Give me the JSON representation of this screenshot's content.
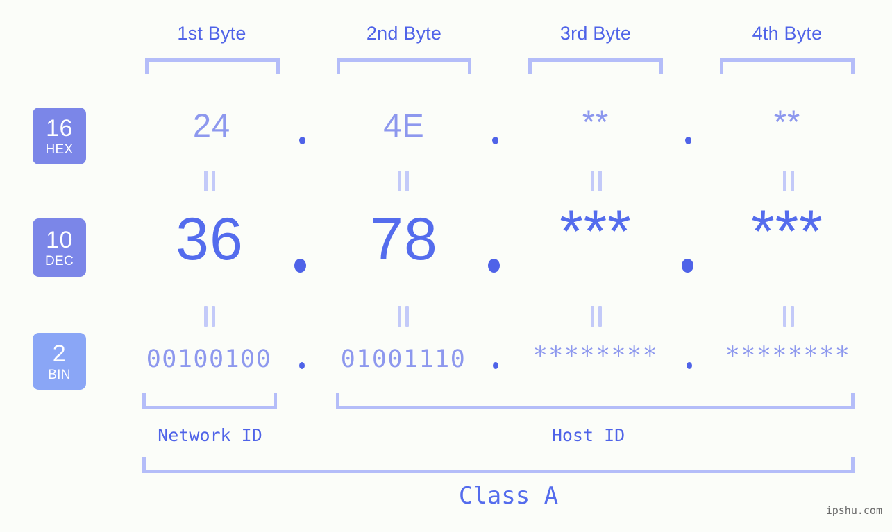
{
  "page": {
    "background": "#fbfdf9",
    "accent": "#4f63e8",
    "accent_light": "#8d98ee",
    "bracket_color": "#b4bdf9",
    "watermark": "ipshu.com"
  },
  "header": {
    "byte_labels": [
      "1st Byte",
      "2nd Byte",
      "3rd Byte",
      "4th Byte"
    ]
  },
  "bases": [
    {
      "num": "16",
      "abbr": "HEX",
      "color": "#7b86e8"
    },
    {
      "num": "10",
      "abbr": "DEC",
      "color": "#7b86e8"
    },
    {
      "num": "2",
      "abbr": "BIN",
      "color": "#8aa6f6"
    }
  ],
  "rows": {
    "hex": {
      "values": [
        "24",
        "4E",
        "**",
        "**"
      ]
    },
    "dec": {
      "values": [
        "36",
        "78",
        "***",
        "***"
      ]
    },
    "bin": {
      "values": [
        "00100100",
        "01001110",
        "********",
        "********"
      ]
    }
  },
  "separators": {
    "dot": "."
  },
  "equals": {
    "symbol": "="
  },
  "footer": {
    "network_id": "Network ID",
    "host_id": "Host ID",
    "class_label": "Class A"
  }
}
